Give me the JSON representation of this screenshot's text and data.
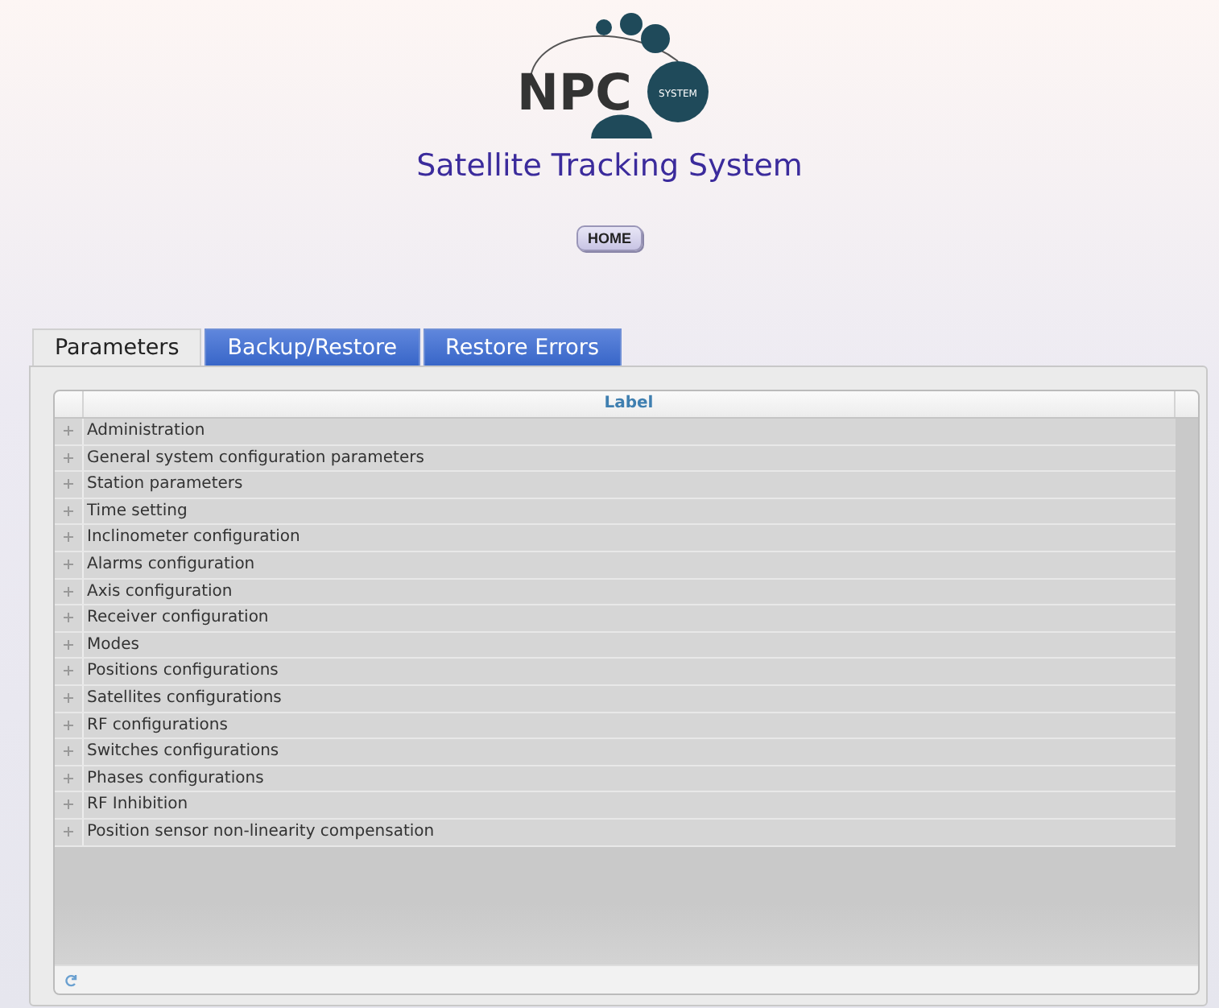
{
  "logo": {
    "text": "NPC",
    "subtext": "SYSTEM"
  },
  "title": "Satellite Tracking System",
  "home_button": "HOME",
  "tabs": [
    {
      "label": "Parameters",
      "selected": true
    },
    {
      "label": "Backup/Restore",
      "selected": false
    },
    {
      "label": "Restore Errors",
      "selected": false
    }
  ],
  "grid": {
    "columns": [
      "Label"
    ],
    "rows": [
      {
        "label": "Administration",
        "expanded": false
      },
      {
        "label": "General system configuration parameters",
        "expanded": false
      },
      {
        "label": "Station parameters",
        "expanded": false
      },
      {
        "label": "Time setting",
        "expanded": false
      },
      {
        "label": "Inclinometer configuration",
        "expanded": false
      },
      {
        "label": "Alarms configuration",
        "expanded": false
      },
      {
        "label": "Axis configuration",
        "expanded": false
      },
      {
        "label": "Receiver configuration",
        "expanded": false
      },
      {
        "label": "Modes",
        "expanded": false
      },
      {
        "label": "Positions configurations",
        "expanded": false
      },
      {
        "label": "Satellites configurations",
        "expanded": false
      },
      {
        "label": "RF configurations",
        "expanded": false
      },
      {
        "label": "Switches configurations",
        "expanded": false
      },
      {
        "label": "Phases configurations",
        "expanded": false
      },
      {
        "label": "RF Inhibition",
        "expanded": false
      },
      {
        "label": "Position sensor non-linearity compensation",
        "expanded": false
      }
    ]
  }
}
